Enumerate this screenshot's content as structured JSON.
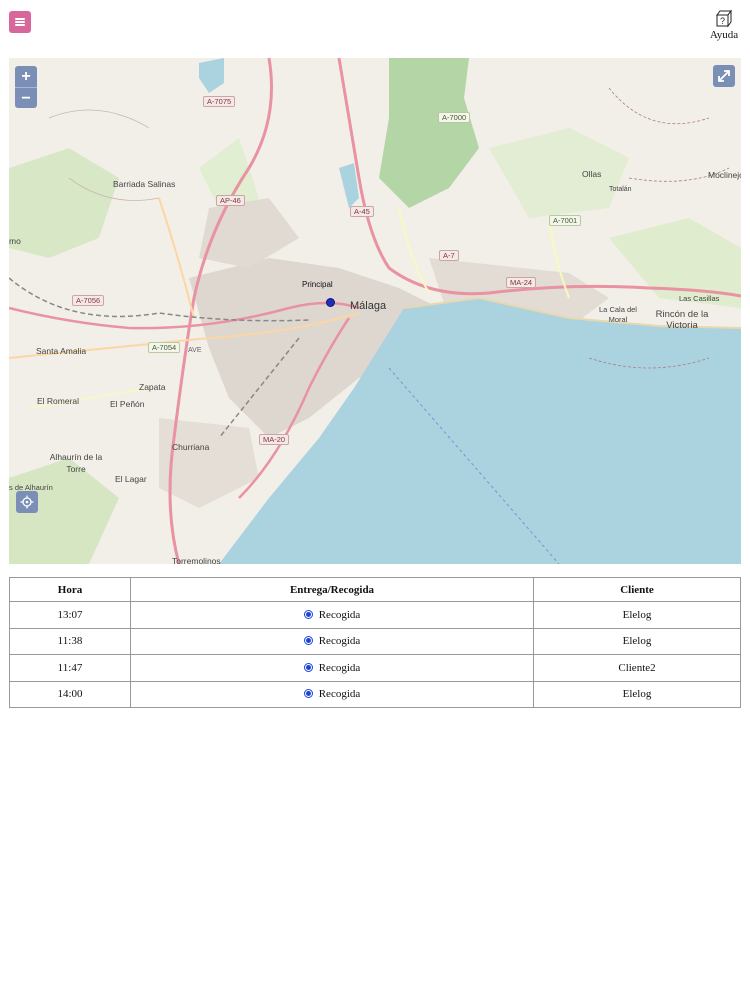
{
  "header": {
    "menu_icon": "hamburger-menu-icon",
    "help_icon": "help-box-icon",
    "help_label": "Ayuda"
  },
  "map": {
    "controls": {
      "zoom_in": "+",
      "zoom_out": "−",
      "fullscreen_icon": "expand-icon",
      "locate_icon": "crosshair-icon"
    },
    "marker_label": "Principal",
    "city": "Málaga",
    "labels": [
      "Barriada Salinas",
      "Santa Amalia",
      "Zapata",
      "El Romeral",
      "El Peñón",
      "Churriana",
      "Alhaurín de la Torre",
      "El Lagar",
      "Ollas",
      "Totalán",
      "Moclinejo",
      "La Cala del Moral",
      "Rincón de la Victoria",
      "Las Casillas",
      "Torremolinos",
      "mo",
      "s de Alhaurín"
    ],
    "roads": [
      "A-7075",
      "A-7000",
      "AP-46",
      "A-45",
      "A-7",
      "A-7001",
      "MA-24",
      "A-7056",
      "A-7054",
      "MA-20",
      "AVE"
    ],
    "colors": {
      "water": "#aad3df",
      "land": "#f2efe9",
      "forest": "#add19e",
      "motorway": "#e892a2",
      "primary": "#fcd6a4"
    }
  },
  "table": {
    "headers": [
      "Hora",
      "Entrega/Recogida",
      "Cliente"
    ],
    "rows": [
      {
        "hora": "13:07",
        "tipo": "Recogida",
        "cliente": "Elelog"
      },
      {
        "hora": "11:38",
        "tipo": "Recogida",
        "cliente": "Elelog"
      },
      {
        "hora": "11:47",
        "tipo": "Recogida",
        "cliente": "Cliente2"
      },
      {
        "hora": "14:00",
        "tipo": "Recogida",
        "cliente": "Elelog"
      }
    ]
  }
}
